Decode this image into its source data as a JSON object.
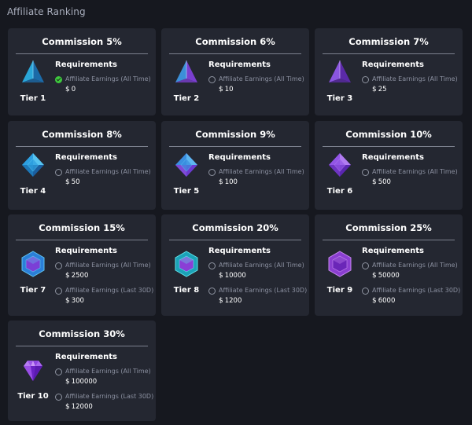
{
  "page": {
    "title": "Affiliate Ranking"
  },
  "currency_symbol": "$",
  "colors": {
    "background": "#16181f",
    "card": "#242731",
    "check_done": "#3ec93e",
    "muted_text": "#8b90a0"
  },
  "cards": [
    {
      "title": "Commission 5%",
      "tier": "Tier 1",
      "gem_icon": "blue-pyramid-icon",
      "requirements_label": "Requirements",
      "requirements": [
        {
          "name": "Affiliate Earnings (All Time)",
          "value": "0",
          "met": true
        }
      ]
    },
    {
      "title": "Commission 6%",
      "tier": "Tier 2",
      "gem_icon": "blue-violet-pyramid-icon",
      "requirements_label": "Requirements",
      "requirements": [
        {
          "name": "Affiliate Earnings (All Time)",
          "value": "10",
          "met": false
        }
      ]
    },
    {
      "title": "Commission 7%",
      "tier": "Tier 3",
      "gem_icon": "violet-pyramid-icon",
      "requirements_label": "Requirements",
      "requirements": [
        {
          "name": "Affiliate Earnings (All Time)",
          "value": "25",
          "met": false
        }
      ]
    },
    {
      "title": "Commission 8%",
      "tier": "Tier 4",
      "gem_icon": "blue-diamond-icon",
      "requirements_label": "Requirements",
      "requirements": [
        {
          "name": "Affiliate Earnings (All Time)",
          "value": "50",
          "met": false
        }
      ]
    },
    {
      "title": "Commission 9%",
      "tier": "Tier 5",
      "gem_icon": "blue-violet-diamond-icon",
      "requirements_label": "Requirements",
      "requirements": [
        {
          "name": "Affiliate Earnings (All Time)",
          "value": "100",
          "met": false
        }
      ]
    },
    {
      "title": "Commission 10%",
      "tier": "Tier 6",
      "gem_icon": "violet-diamond-icon",
      "requirements_label": "Requirements",
      "requirements": [
        {
          "name": "Affiliate Earnings (All Time)",
          "value": "500",
          "met": false
        }
      ]
    },
    {
      "title": "Commission 15%",
      "tier": "Tier 7",
      "gem_icon": "violet-hexagon-gem-icon",
      "requirements_label": "Requirements",
      "requirements": [
        {
          "name": "Affiliate Earnings (All Time)",
          "value": "2500",
          "met": false
        },
        {
          "name": "Affiliate Earnings (Last 30D)",
          "value": "300",
          "met": false
        }
      ]
    },
    {
      "title": "Commission 20%",
      "tier": "Tier 8",
      "gem_icon": "teal-violet-hexagon-gem-icon",
      "requirements_label": "Requirements",
      "requirements": [
        {
          "name": "Affiliate Earnings (All Time)",
          "value": "10000",
          "met": false
        },
        {
          "name": "Affiliate Earnings (Last 30D)",
          "value": "1200",
          "met": false
        }
      ]
    },
    {
      "title": "Commission 25%",
      "tier": "Tier 9",
      "gem_icon": "purple-hexagon-gem-icon",
      "requirements_label": "Requirements",
      "requirements": [
        {
          "name": "Affiliate Earnings (All Time)",
          "value": "50000",
          "met": false
        },
        {
          "name": "Affiliate Earnings (Last 30D)",
          "value": "6000",
          "met": false
        }
      ]
    },
    {
      "title": "Commission 30%",
      "tier": "Tier 10",
      "gem_icon": "purple-brilliant-diamond-icon",
      "requirements_label": "Requirements",
      "requirements": [
        {
          "name": "Affiliate Earnings (All Time)",
          "value": "100000",
          "met": false
        },
        {
          "name": "Affiliate Earnings (Last 30D)",
          "value": "12000",
          "met": false
        }
      ]
    }
  ]
}
